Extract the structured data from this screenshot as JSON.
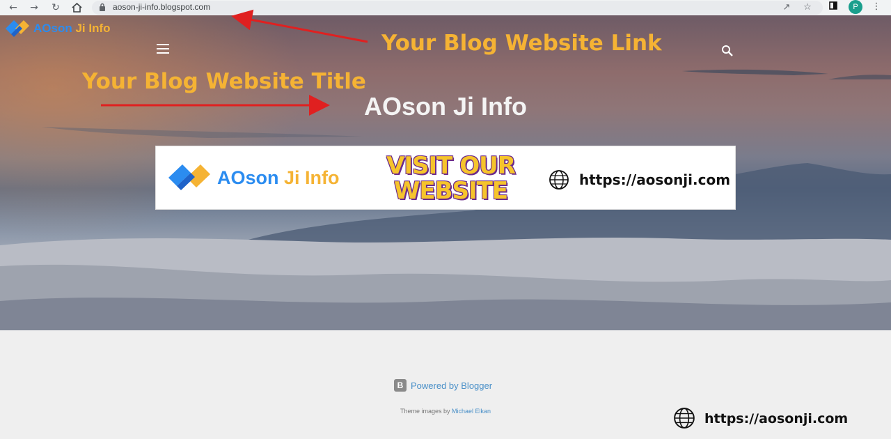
{
  "browser": {
    "url": "aoson-ji-info.blogspot.com",
    "profile_initial": "P",
    "icons": [
      "back-icon",
      "forward-icon",
      "reload-icon",
      "home-icon",
      "lock-icon",
      "share-icon",
      "star-icon",
      "side-panel-icon",
      "profile-avatar",
      "menu-kebab-icon"
    ]
  },
  "site": {
    "logo_text_part1": "AOson",
    "logo_text_part2": "Ji Info",
    "blog_title": "AOson Ji Info"
  },
  "annotations": {
    "link_label": "Your Blog Website Link",
    "title_label": "Your Blog Website Title",
    "color": "#f5b334",
    "arrow_color": "#e02020"
  },
  "banner": {
    "logo_part1": "AOson",
    "logo_part2": "Ji Info",
    "visit_line1": "VISIT OUR",
    "visit_line2": "WEBSITE",
    "url": "https://aosonji.com"
  },
  "footer": {
    "powered_by": "Powered by Blogger",
    "blogger_icon_letter": "B",
    "theme_prefix": "Theme images by",
    "theme_author": "Michael Elkan",
    "corner_url": "https://aosonji.com"
  }
}
